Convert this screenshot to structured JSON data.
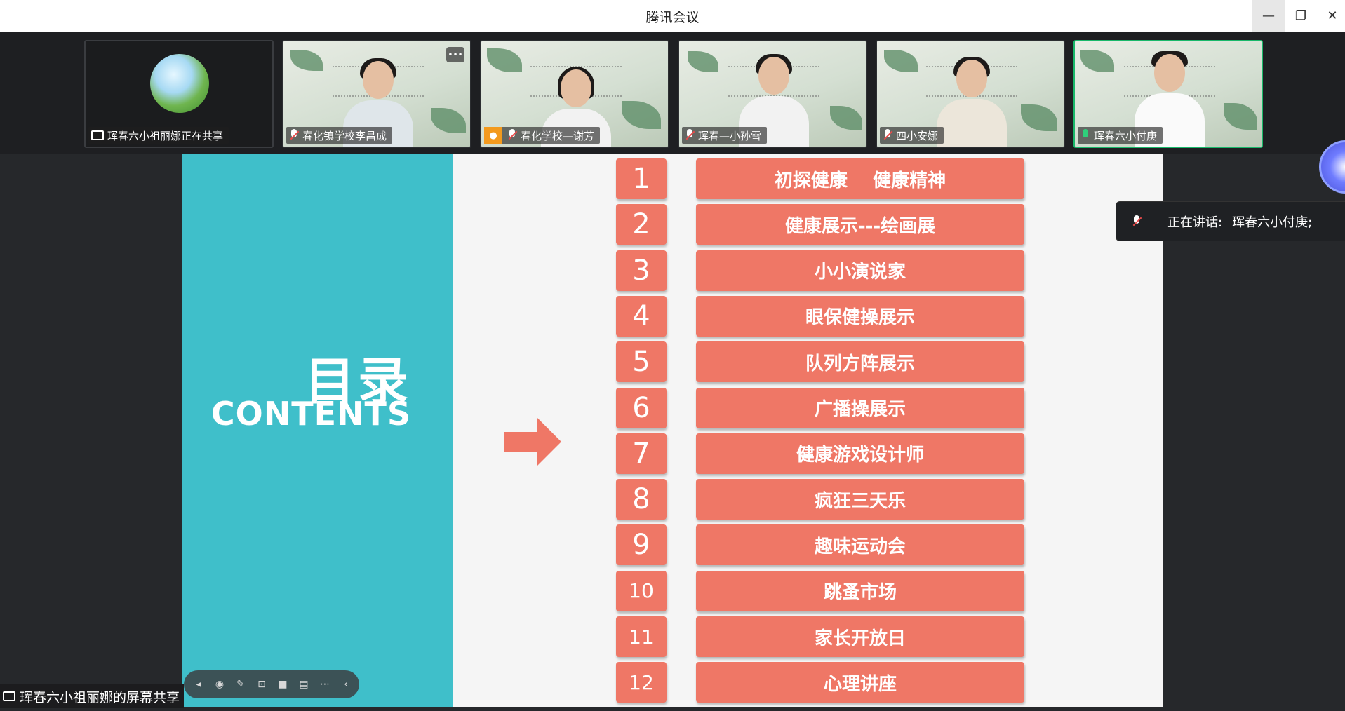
{
  "window": {
    "title": "腾讯会议",
    "minimize_glyph": "—",
    "maximize_glyph": "❐",
    "close_glyph": "✕"
  },
  "participants": [
    {
      "label": "珲春六小祖丽娜正在共享",
      "icon": "screen-share-icon"
    },
    {
      "label": "春化镇学校李昌成",
      "icon": "mic-off-icon"
    },
    {
      "label": "春化学校—谢芳",
      "icon": "mic-off-icon"
    },
    {
      "label": "珲春—小孙雪",
      "icon": "mic-off-icon"
    },
    {
      "label": "四小安娜",
      "icon": "mic-off-icon"
    },
    {
      "label": "珲春六小付庚",
      "icon": "mic-on-icon"
    }
  ],
  "tile_more_glyph": "•••",
  "slide": {
    "title_cn": "目录",
    "title_en": "CONTENTS",
    "accent_color": "#3fbfca",
    "item_color": "#ef7766",
    "numbers": [
      "1",
      "2",
      "3",
      "4",
      "5",
      "6",
      "7",
      "8",
      "9",
      "10",
      "11",
      "12"
    ],
    "items": [
      "初探健康    健康精神",
      "健康展示---绘画展",
      "小小演说家",
      "眼保健操展示",
      "队列方阵展示",
      "广播操展示",
      "健康游戏设计师",
      "疯狂三天乐",
      "趣味运动会",
      "跳蚤市场",
      "家长开放日",
      "心理讲座"
    ]
  },
  "speaking": {
    "prefix": "正在讲话:",
    "name": "珲春六小付庚;"
  },
  "share_bar": {
    "label": "珲春六小祖丽娜的屏幕共享"
  },
  "toolbar_icons": [
    "back-icon",
    "pointer-icon",
    "pen-icon",
    "capture-icon",
    "camera-icon",
    "chat-icon",
    "more-icon",
    "collapse-icon"
  ]
}
